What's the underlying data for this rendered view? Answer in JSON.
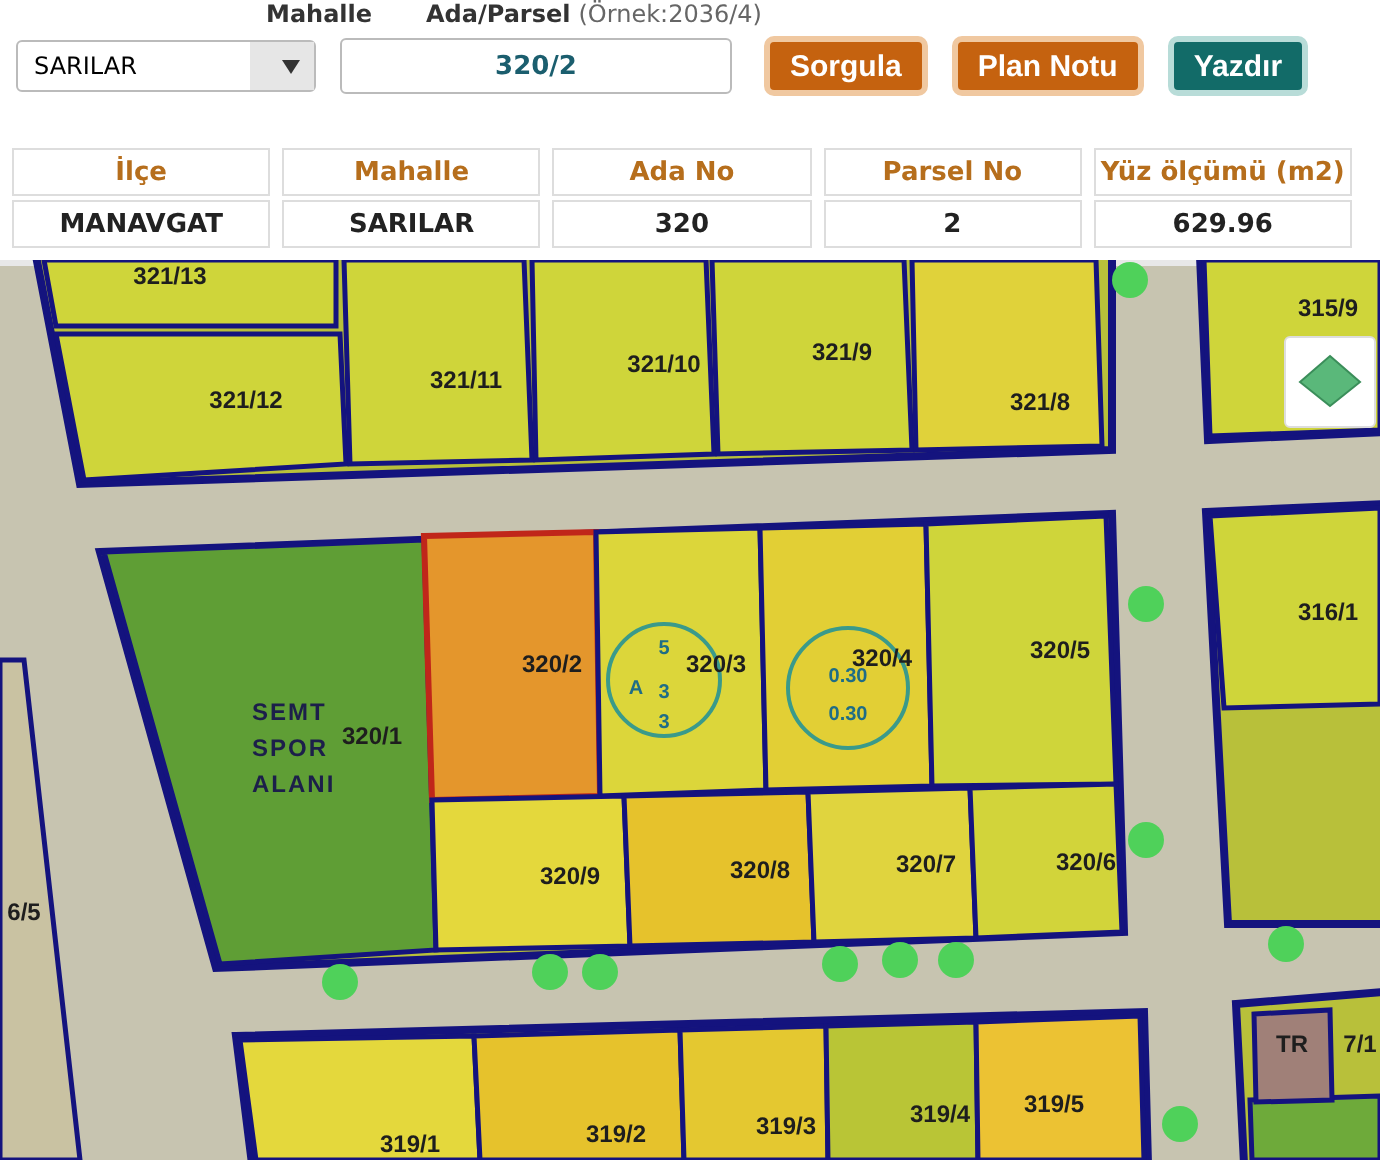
{
  "form": {
    "labels": [
      "Mahalle",
      "Ada/Parsel"
    ],
    "example": "(Örnek:2036/4)",
    "mahalle_select": {
      "value": "SARILAR"
    },
    "parcel_field": {
      "value": "320/2"
    },
    "buttons": [
      {
        "label": "Sorgula",
        "kind": "query"
      },
      {
        "label": "Plan Notu",
        "kind": "query"
      },
      {
        "label": "Yazdır",
        "kind": "print"
      }
    ]
  },
  "table": {
    "columns": [
      "İlçe",
      "Mahalle",
      "Ada No",
      "Parsel No",
      "Yüz ölçümü (m2)"
    ],
    "rows": [
      [
        "MANAVGAT",
        "SARILAR",
        "320",
        "2",
        "629.96"
      ]
    ]
  },
  "map": {
    "parcels": [
      {
        "label": "321/13",
        "selected": false
      },
      {
        "label": "321/12",
        "selected": false
      },
      {
        "label": "321/11",
        "selected": false
      },
      {
        "label": "321/10",
        "selected": false
      },
      {
        "label": "321/9",
        "selected": false
      },
      {
        "label": "321/8",
        "selected": false
      },
      {
        "label": "315/9",
        "selected": false
      },
      {
        "label": "316/1",
        "selected": false
      },
      {
        "label": "320/1",
        "selected": false
      },
      {
        "label": "320/2",
        "selected": true
      },
      {
        "label": "320/3",
        "selected": false
      },
      {
        "label": "320/4",
        "selected": false
      },
      {
        "label": "320/5",
        "selected": false
      },
      {
        "label": "320/9",
        "selected": false
      },
      {
        "label": "320/8",
        "selected": false
      },
      {
        "label": "320/7",
        "selected": false
      },
      {
        "label": "320/6",
        "selected": false
      },
      {
        "label": "319/1",
        "selected": false
      },
      {
        "label": "319/2",
        "selected": false
      },
      {
        "label": "319/3",
        "selected": false
      },
      {
        "label": "319/4",
        "selected": false
      },
      {
        "label": "319/5",
        "selected": false
      },
      {
        "label": "6/5",
        "selected": false
      },
      {
        "label": "7/1",
        "selected": false
      }
    ],
    "zone_label": [
      "SEMT",
      "SPOR",
      "ALANI"
    ],
    "plan_notes": [
      {
        "texts": [
          "5",
          "A",
          "3",
          "3"
        ]
      },
      {
        "texts": [
          "0.30",
          "0.30"
        ]
      }
    ],
    "tr_label": "TR"
  }
}
